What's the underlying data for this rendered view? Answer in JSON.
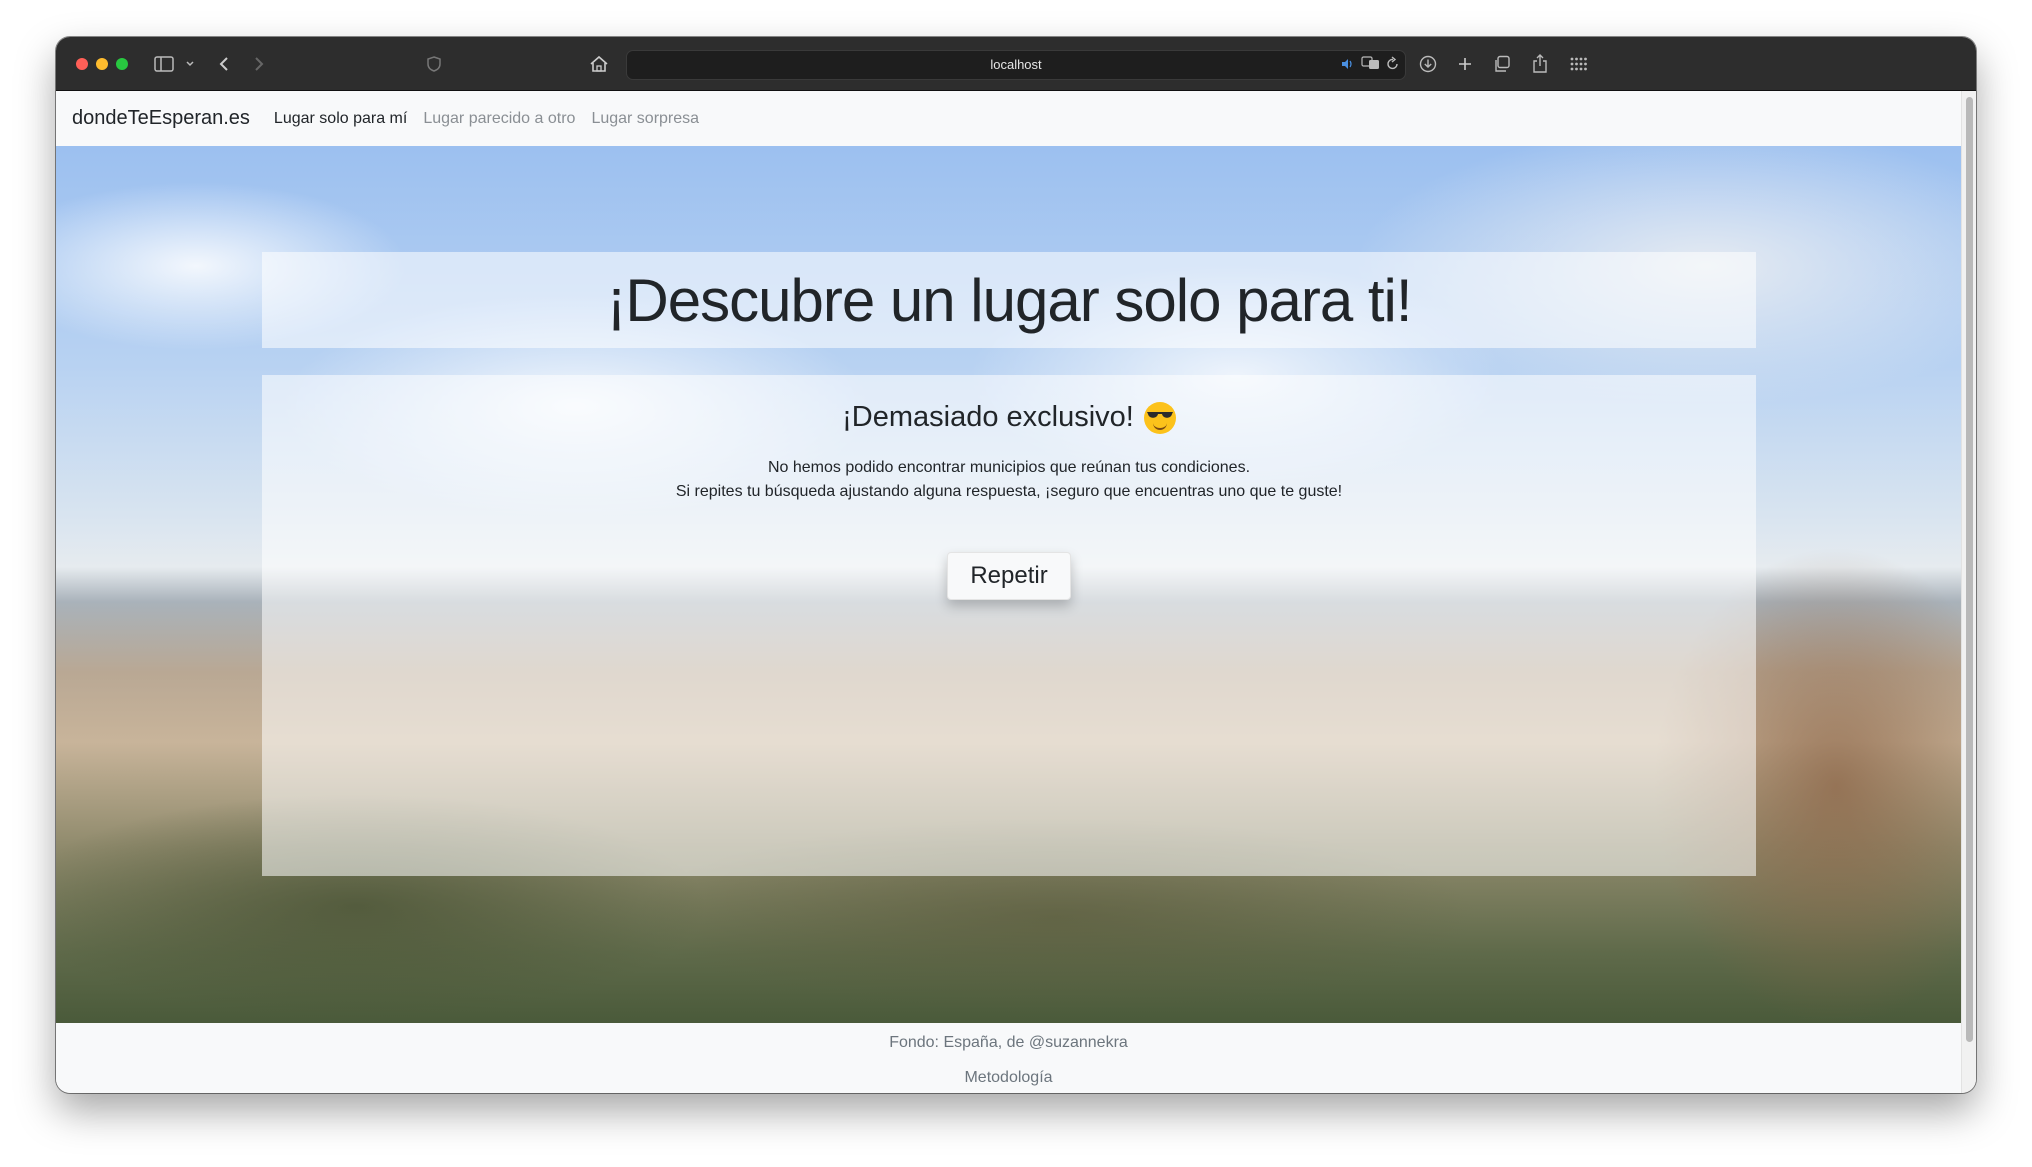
{
  "browser": {
    "url": "localhost",
    "icons": [
      "sidebar-icon",
      "chevron-down-icon",
      "back-icon",
      "forward-icon",
      "shield-icon",
      "home-icon",
      "speaker-icon",
      "translate-icon",
      "reload-icon",
      "download-icon",
      "new-tab-icon",
      "tabs-icon",
      "share-icon",
      "grid-icon"
    ]
  },
  "navbar": {
    "brand": "dondeTeEsperan.es",
    "links": [
      {
        "label": "Lugar solo para mí",
        "active": true
      },
      {
        "label": "Lugar parecido a otro",
        "active": false
      },
      {
        "label": "Lugar sorpresa",
        "active": false
      }
    ]
  },
  "main": {
    "title": "¡Descubre un lugar solo para ti!",
    "subtitle": "¡Demasiado exclusivo!",
    "emoji": "smiling-face-with-sunglasses",
    "message_line1": "No hemos podido encontrar municipios que reúnan tus condiciones.",
    "message_line2": "Si repites tu búsqueda ajustando alguna respuesta, ¡seguro que encuentras uno que te guste!",
    "button_label": "Repetir"
  },
  "footer": {
    "credit": "Fondo: España, de @suzannekra",
    "methodology": "Metodología"
  },
  "colors": {
    "titlebar": "#2d2d2d",
    "navbar": "#f8f9fa",
    "text": "#212529",
    "muted": "#6c757d"
  }
}
